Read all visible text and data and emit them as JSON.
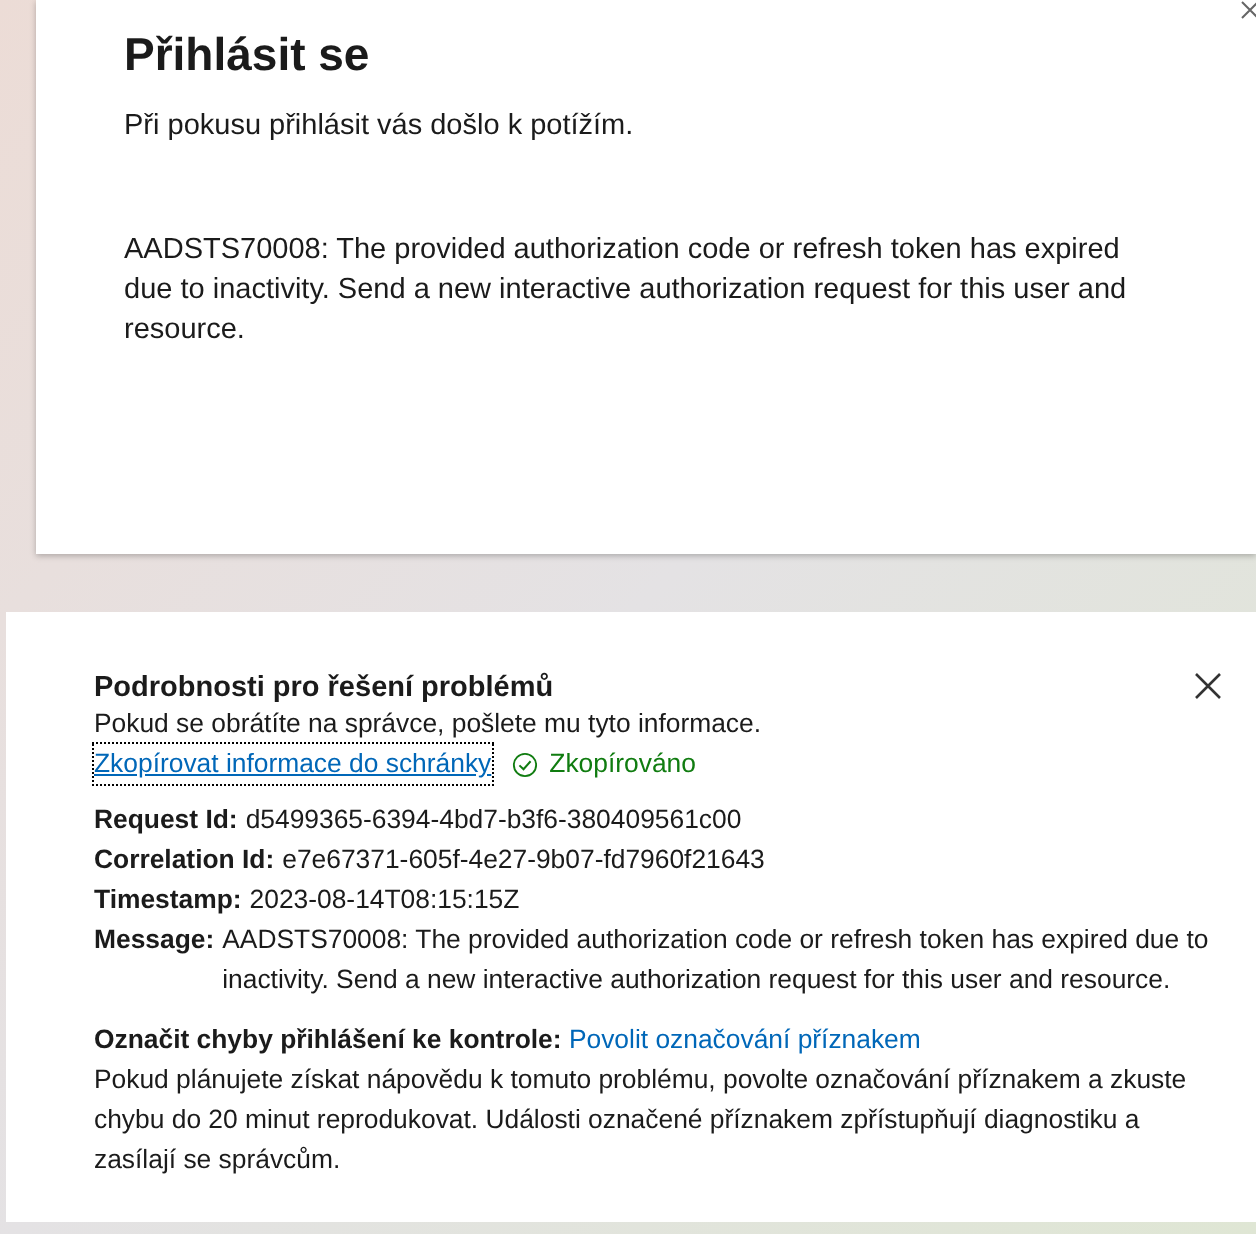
{
  "sign_in_card": {
    "title": "Přihlásit se",
    "subtitle": "Při pokusu přihlásit vás došlo k potížím.",
    "error": "AADSTS70008: The provided authorization code or refresh token has expired due to inactivity. Send a new interactive authorization request for this user and resource."
  },
  "details_panel": {
    "title": "Podrobnosti pro řešení problémů",
    "hint": "Pokud se obrátíte na správce, pošlete mu tyto informace.",
    "copy_link": "Zkopírovat informace do schránky",
    "copied_status": "Zkopírováno",
    "fields": [
      {
        "label": "Request Id:",
        "value": "d5499365-6394-4bd7-b3f6-380409561c00"
      },
      {
        "label": "Correlation Id:",
        "value": "e7e67371-605f-4e27-9b07-fd7960f21643"
      },
      {
        "label": "Timestamp:",
        "value": "2023-08-14T08:15:15Z"
      },
      {
        "label": "Message:",
        "value": "AADSTS70008: The provided authorization code or refresh token has expired due to inactivity. Send a new interactive authorization request for this user and resource."
      }
    ],
    "flag_label": "Označit chyby přihlášení ke kontrole:",
    "flag_link": "Povolit označování příznakem",
    "flag_description": "Pokud plánujete získat nápovědu k tomuto problému, povolte označování příznakem a zkuste chybu do 20 minut reprodukovat. Události označené příznakem zpřístupňují diagnostiku a zasílají se správcům."
  }
}
